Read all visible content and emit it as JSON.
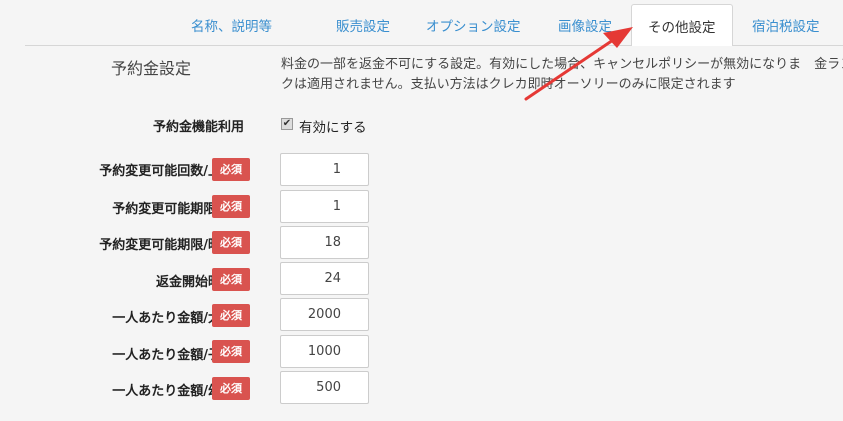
{
  "tabs": [
    {
      "label": "名称、説明等"
    },
    {
      "label": "販売設定"
    },
    {
      "label": "オプション設定"
    },
    {
      "label": "画像設定"
    },
    {
      "label": "その他設定",
      "active": true
    },
    {
      "label": "宿泊税設定"
    }
  ],
  "section": {
    "title": "予約金設定",
    "description": "料金の一部を返金不可にする設定。有効にした場合、キャンセルポリシーが無効になりま　金ランクは適用されません。支払い方法はクレカ即時オーソリーのみに限定されます"
  },
  "feature": {
    "label": "予約金機能利用",
    "checkbox_label": "有効にする",
    "checked": true
  },
  "required_badge": "必須",
  "help_icon": "question-circle-icon",
  "fields": [
    {
      "label": "予約変更可能回数/上限",
      "value": "1"
    },
    {
      "label": "予約変更可能期限/日",
      "value": "1"
    },
    {
      "label": "予約変更可能期限/時間",
      "value": "18"
    },
    {
      "label": "返金開始時間",
      "value": "24"
    },
    {
      "label": "一人あたり金額/大人",
      "value": "2000"
    },
    {
      "label": "一人あたり金額/子供",
      "value": "1000"
    },
    {
      "label": "一人あたり金額/幼児",
      "value": "500"
    }
  ],
  "colors": {
    "tab_link": "#3a8fcf",
    "required_badge": "#d9534f",
    "annotation_arrow": "#e53935",
    "background": "#f5f5f5"
  }
}
